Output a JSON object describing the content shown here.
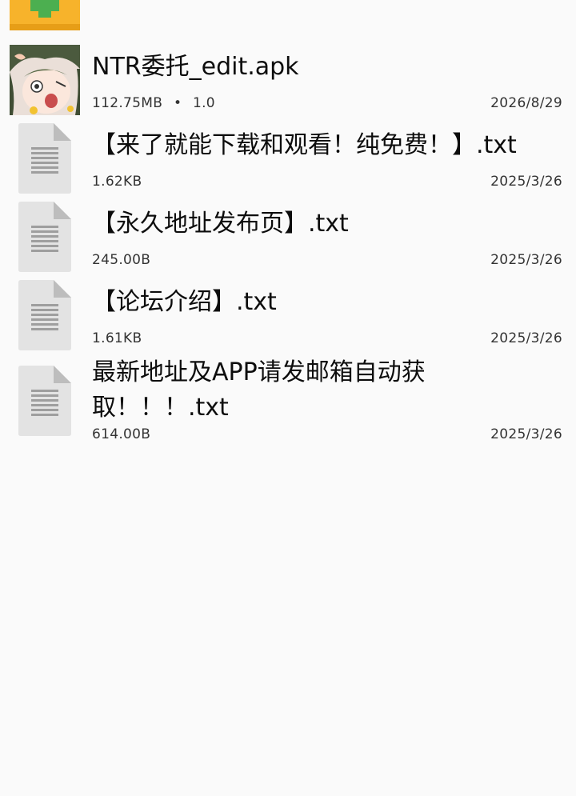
{
  "files": [
    {
      "name": "NTR委托_edit.apk",
      "size": "112.75MB",
      "separator": "•",
      "version": "1.0",
      "date": "2026/8/29",
      "icon": "app-thumbnail-icon"
    },
    {
      "name": "【来了就能下载和观看！纯免费！】.txt",
      "size": "1.62KB",
      "date": "2025/3/26",
      "icon": "text-file-icon"
    },
    {
      "name": "【永久地址发布页】.txt",
      "size": "245.00B",
      "date": "2025/3/26",
      "icon": "text-file-icon"
    },
    {
      "name": "【论坛介绍】.txt",
      "size": "1.61KB",
      "date": "2025/3/26",
      "icon": "text-file-icon"
    },
    {
      "name": "最新地址及APP请发邮箱自动获取！！！.txt",
      "size": "614.00B",
      "date": "2025/3/26",
      "icon": "text-file-icon"
    }
  ],
  "colors": {
    "folder": "#f7b32b",
    "folder_plus": "#4caf50",
    "doc": "#e3e3e3",
    "doc_fold": "#bdbdbd",
    "doc_lines": "#9e9e9e"
  }
}
